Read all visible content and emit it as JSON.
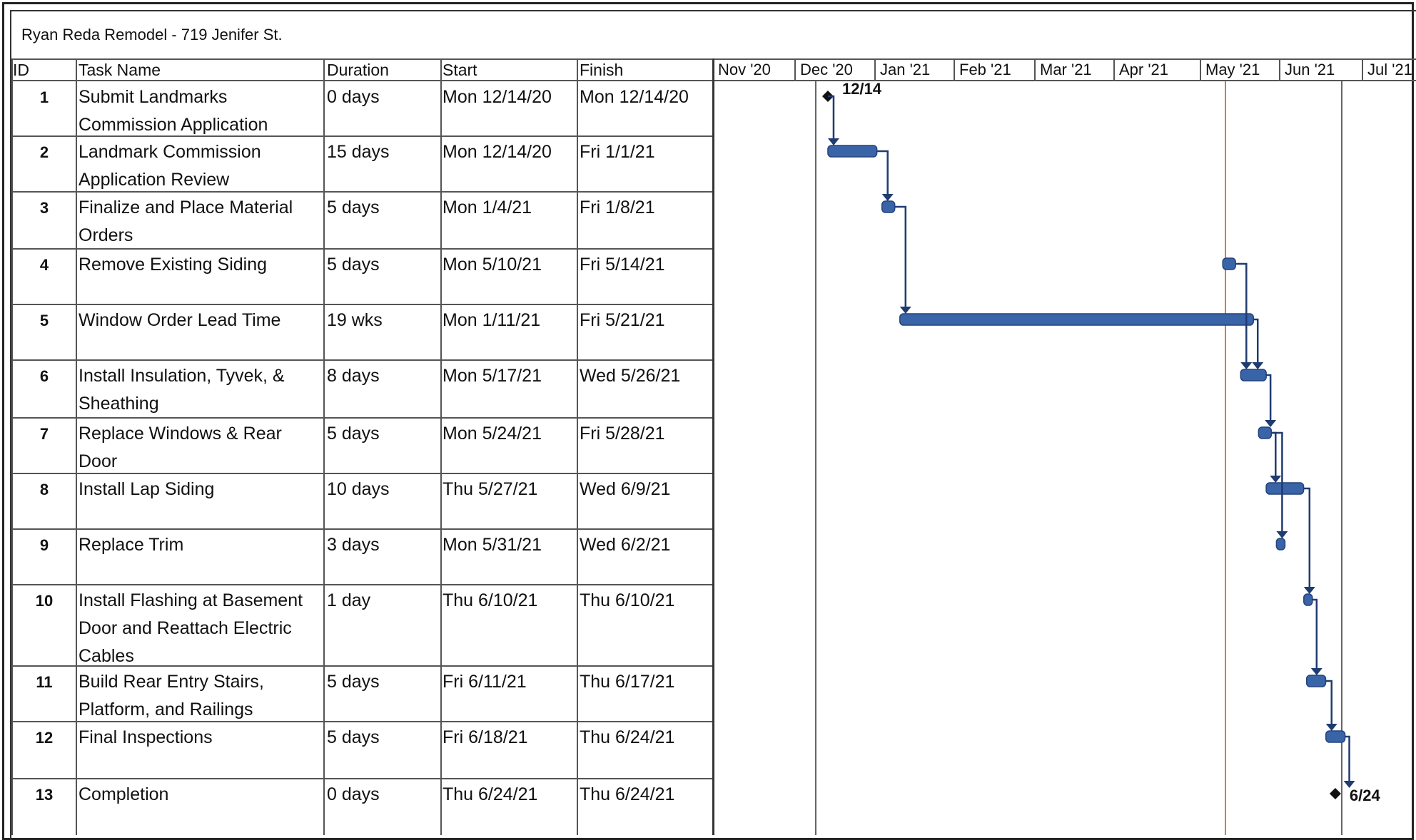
{
  "title": "Ryan Reda Remodel - 719 Jenifer St.",
  "columns": {
    "id": "ID",
    "name": "Task Name",
    "duration": "Duration",
    "start": "Start",
    "finish": "Finish"
  },
  "colors": {
    "bar": "#3a64a8",
    "bar_edge": "#24427a",
    "link": "#1f3b70",
    "status_line": "#e07a2a",
    "grid": "#555555"
  },
  "chart_data": {
    "type": "gantt",
    "title": "Ryan Reda Remodel - 719 Jenifer St.",
    "timescale": [
      "Nov '20",
      "Dec '20",
      "Jan '21",
      "Feb '21",
      "Mar '21",
      "Apr '21",
      "May '21",
      "Jun '21",
      "Jul '21"
    ],
    "x_range": [
      "2020-11-01",
      "2021-07-31"
    ],
    "status_date": "2021-05-10",
    "milestone_labels": {
      "1": "12/14",
      "13": "6/24"
    },
    "tasks": [
      {
        "id": "1",
        "name": "Submit Landmarks Commission Application",
        "duration": "0 days",
        "start": "Mon 12/14/20",
        "finish": "Mon 12/14/20",
        "start_date": "2020-12-14",
        "finish_date": "2020-12-14",
        "milestone": true
      },
      {
        "id": "2",
        "name": "Landmark Commission Application Review",
        "duration": "15 days",
        "start": "Mon 12/14/20",
        "finish": "Fri 1/1/21",
        "start_date": "2020-12-14",
        "finish_date": "2021-01-01",
        "milestone": false
      },
      {
        "id": "3",
        "name": "Finalize and Place Material Orders",
        "duration": "5 days",
        "start": "Mon 1/4/21",
        "finish": "Fri 1/8/21",
        "start_date": "2021-01-04",
        "finish_date": "2021-01-08",
        "milestone": false
      },
      {
        "id": "4",
        "name": "Remove Existing Siding",
        "duration": "5 days",
        "start": "Mon 5/10/21",
        "finish": "Fri 5/14/21",
        "start_date": "2021-05-10",
        "finish_date": "2021-05-14",
        "milestone": false
      },
      {
        "id": "5",
        "name": "Window Order Lead Time",
        "duration": "19 wks",
        "start": "Mon 1/11/21",
        "finish": "Fri 5/21/21",
        "start_date": "2021-01-11",
        "finish_date": "2021-05-21",
        "milestone": false
      },
      {
        "id": "6",
        "name": "Install Insulation, Tyvek, & Sheathing",
        "duration": "8 days",
        "start": "Mon 5/17/21",
        "finish": "Wed 5/26/21",
        "start_date": "2021-05-17",
        "finish_date": "2021-05-26",
        "milestone": false
      },
      {
        "id": "7",
        "name": "Replace Windows & Rear Door",
        "duration": "5 days",
        "start": "Mon 5/24/21",
        "finish": "Fri 5/28/21",
        "start_date": "2021-05-24",
        "finish_date": "2021-05-28",
        "milestone": false
      },
      {
        "id": "8",
        "name": "Install Lap Siding",
        "duration": "10 days",
        "start": "Thu 5/27/21",
        "finish": "Wed 6/9/21",
        "start_date": "2021-05-27",
        "finish_date": "2021-06-09",
        "milestone": false
      },
      {
        "id": "9",
        "name": "Replace Trim",
        "duration": "3 days",
        "start": "Mon 5/31/21",
        "finish": "Wed 6/2/21",
        "start_date": "2021-05-31",
        "finish_date": "2021-06-02",
        "milestone": false
      },
      {
        "id": "10",
        "name": "Install Flashing at Basement Door and Reattach Electric Cables",
        "duration": "1 day",
        "start": "Thu 6/10/21",
        "finish": "Thu 6/10/21",
        "start_date": "2021-06-10",
        "finish_date": "2021-06-10",
        "milestone": false
      },
      {
        "id": "11",
        "name": "Build Rear Entry Stairs, Platform, and Railings",
        "duration": "5 days",
        "start": "Fri 6/11/21",
        "finish": "Thu 6/17/21",
        "start_date": "2021-06-11",
        "finish_date": "2021-06-17",
        "milestone": false
      },
      {
        "id": "12",
        "name": "Final Inspections",
        "duration": "5 days",
        "start": "Fri 6/18/21",
        "finish": "Thu 6/24/21",
        "start_date": "2021-06-18",
        "finish_date": "2021-06-24",
        "milestone": false
      },
      {
        "id": "13",
        "name": "Completion",
        "duration": "0 days",
        "start": "Thu 6/24/21",
        "finish": "Thu 6/24/21",
        "start_date": "2021-06-24",
        "finish_date": "2021-06-24",
        "milestone": true
      }
    ],
    "links": [
      [
        1,
        2
      ],
      [
        2,
        3
      ],
      [
        3,
        5
      ],
      [
        4,
        6
      ],
      [
        5,
        6
      ],
      [
        6,
        7
      ],
      [
        7,
        8
      ],
      [
        7,
        9
      ],
      [
        8,
        10
      ],
      [
        10,
        11
      ],
      [
        11,
        12
      ],
      [
        12,
        13
      ]
    ]
  }
}
